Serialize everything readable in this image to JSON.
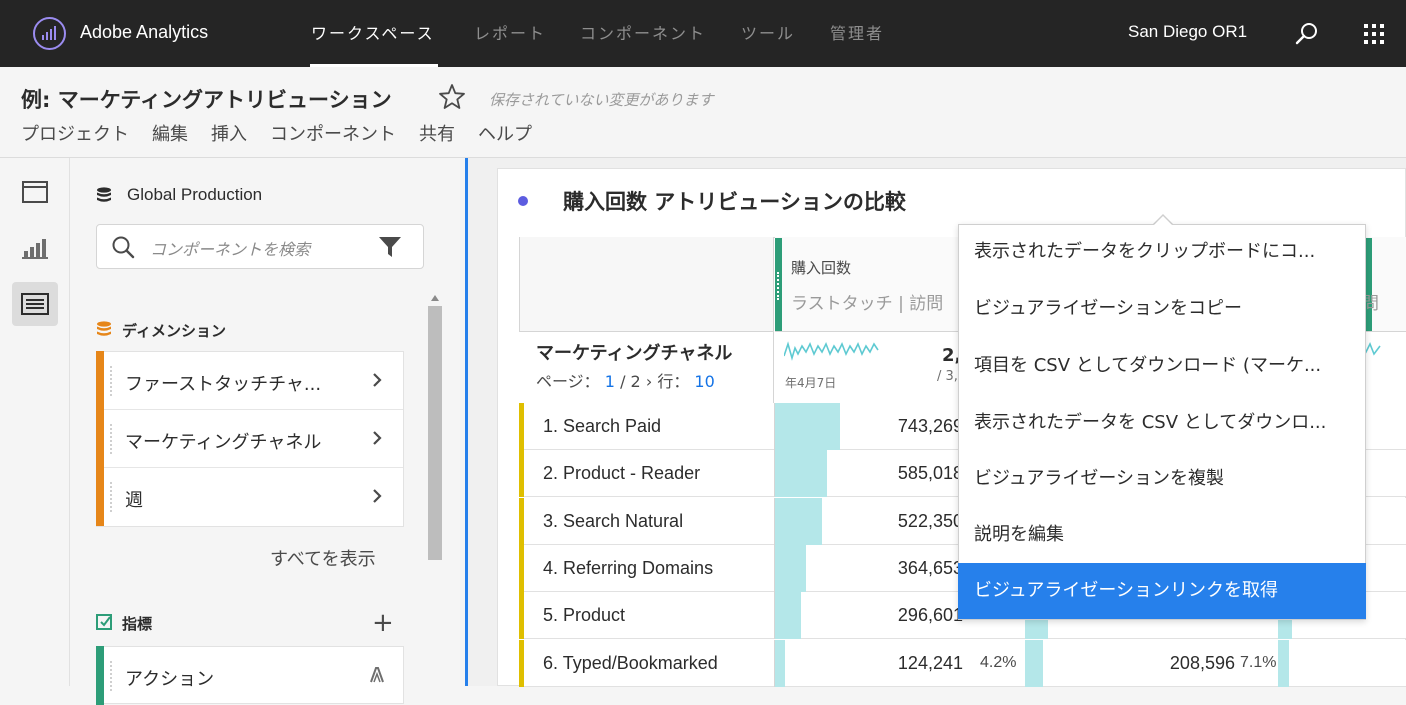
{
  "app": {
    "name": "Adobe Analytics",
    "nav": [
      "ワークスペース",
      "レポート",
      "コンポーネント",
      "ツール",
      "管理者"
    ],
    "active_nav": "ワークスペース",
    "company": "San Diego OR1",
    "icons": [
      "analytics-logo-icon",
      "search-icon",
      "apps-grid-icon"
    ]
  },
  "project": {
    "title": "例: マーケティングアトリビューション",
    "unsaved": "保存されていない変更があります",
    "menu": [
      "プロジェクト",
      "編集",
      "挿入",
      "コンポーネント",
      "共有",
      "ヘルプ"
    ]
  },
  "panel": {
    "report_suite": "Global Production",
    "search_placeholder": "コンポーネントを検索",
    "dimensions_title": "ディメンション",
    "dimensions": [
      "ファーストタッチチャ...",
      "マーケティングチャネル",
      "週"
    ],
    "show_all": "すべてを表示",
    "metrics_title": "指標",
    "metrics": [
      "アクション"
    ]
  },
  "freeform": {
    "title": "購入回数 アトリビューションの比較",
    "metric_name": "購入回数",
    "metric_sub": "ラストタッチ | 訪問",
    "metric_sub_right": "問",
    "dimension_name": "マーケティングチャネル",
    "page_label": "ページ：",
    "page_current": "1",
    "page_total": "/ 2",
    "rows_label": "行：",
    "rows_value": "10",
    "spark_date": "年4月7日",
    "total_value": "2,",
    "total_sub": "/ 3,",
    "rows": [
      {
        "name": "1. Search Paid",
        "value": "743,269",
        "pct": "",
        "value2": "",
        "pct2": "",
        "share": 0.25,
        "share2": 0,
        "share3": 0
      },
      {
        "name": "2. Product - Reader",
        "value": "585,018",
        "pct": "",
        "value2": "",
        "pct2": "",
        "share": 0.2,
        "share2": 0,
        "share3": 0
      },
      {
        "name": "3. Search Natural",
        "value": "522,350",
        "pct": "",
        "value2": "",
        "pct2": "",
        "share": 0.18,
        "share2": 0,
        "share3": 0
      },
      {
        "name": "4. Referring Domains",
        "value": "364,653",
        "pct": "",
        "value2": "",
        "pct2": "",
        "share": 0.12,
        "share2": 0,
        "share3": 0
      },
      {
        "name": "5. Product",
        "value": "296,601",
        "pct": "",
        "value2": "",
        "pct2": "",
        "share": 0.1,
        "share2": 0.09,
        "share3": 0.09
      },
      {
        "name": "6. Typed/Bookmarked",
        "value": "124,241",
        "pct": "4.2%",
        "value2": "208,596",
        "pct2": "7.1%",
        "share": 0.04,
        "share2": 0.07,
        "share3": 0.07
      }
    ]
  },
  "context_menu": {
    "items": [
      "表示されたデータをクリップボードにコ...",
      "ビジュアライゼーションをコピー",
      "項目を CSV としてダウンロード (マーケ...",
      "表示されたデータを CSV としてダウンロ...",
      "ビジュアライゼーションを複製",
      "説明を編集",
      "ビジュアライゼーションリンクを取得"
    ],
    "selected_index": 6
  },
  "colors": {
    "topbar": "#252525",
    "accent": "#2680eb",
    "dimension": "#e68619",
    "metric": "#2d9d78",
    "row_marker": "#dfbf00",
    "bar_fill": "#b4e7e9"
  }
}
